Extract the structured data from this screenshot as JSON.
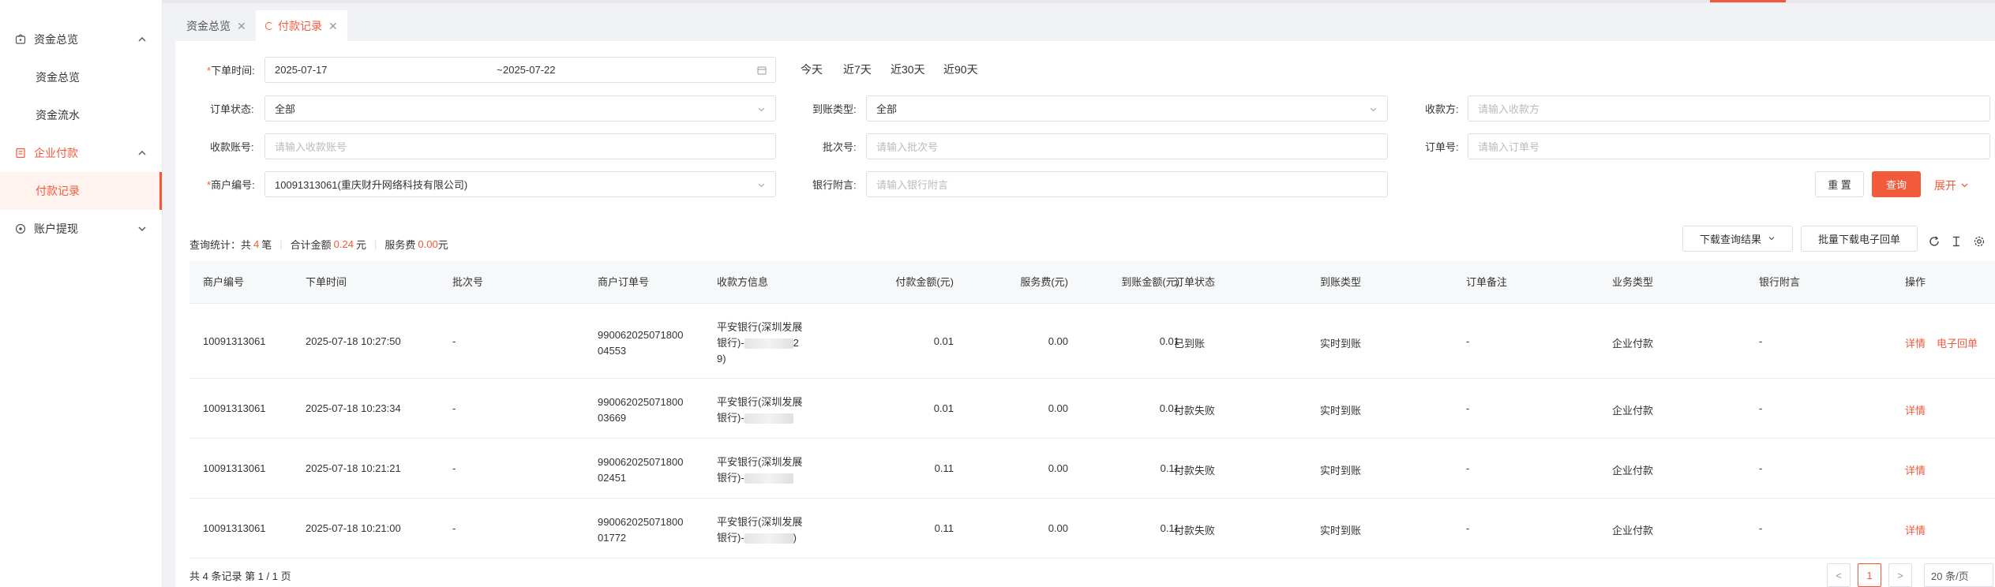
{
  "sidebar": {
    "groups": [
      {
        "label": "资金总览",
        "icon": "wallet-icon",
        "items": [
          "资金总览",
          "资金流水"
        ]
      },
      {
        "label": "企业付款",
        "icon": "document-icon",
        "items": [
          "付款记录"
        ]
      },
      {
        "label": "账户提现",
        "icon": "withdraw-icon",
        "items": []
      }
    ]
  },
  "tabs": [
    {
      "label": "资金总览"
    },
    {
      "label": "付款记录"
    }
  ],
  "filters": {
    "order_time_label": "下单时间:",
    "date_start": "2025-07-17",
    "date_sep": "~",
    "date_end": "2025-07-22",
    "quick": [
      "今天",
      "近7天",
      "近30天",
      "近90天"
    ],
    "order_status_label": "订单状态:",
    "order_status_value": "全部",
    "arrival_type_label": "到账类型:",
    "arrival_type_value": "全部",
    "payee_label": "收款方:",
    "payee_placeholder": "请输入收款方",
    "account_label": "收款账号:",
    "account_placeholder": "请输入收款账号",
    "batch_label": "批次号:",
    "batch_placeholder": "请输入批次号",
    "order_no_label": "订单号:",
    "order_no_placeholder": "请输入订单号",
    "merchant_label": "商户编号:",
    "merchant_value": "10091313061(重庆财升网络科技有限公司)",
    "bank_note_label": "银行附言:",
    "bank_note_placeholder": "请输入银行附言",
    "reset": "重 置",
    "search": "查询",
    "expand": "展开"
  },
  "stats": {
    "prefix": "查询统计：共",
    "count": "4",
    "count_unit": "笔",
    "amount_label": "合计金额",
    "amount": "0.24",
    "amount_unit": "元",
    "fee_label": "服务费",
    "fee": "0.00",
    "fee_unit": "元"
  },
  "toolbar": {
    "download": "下载查询结果",
    "batch_download": "批量下载电子回单"
  },
  "table": {
    "headers": [
      "商户编号",
      "下单时间",
      "批次号",
      "商户订单号",
      "收款方信息",
      "付款金额(元)",
      "服务费(元)",
      "到账金额(元)",
      "订单状态",
      "到账类型",
      "订单备注",
      "业务类型",
      "银行附言",
      "操作"
    ],
    "rows": [
      {
        "merchant": "10091313061",
        "time": "2025-07-18 10:27:50",
        "batch": "-",
        "order_l1": "990062025071800",
        "order_l2": "04553",
        "payee_l1": "平安银行(深圳发展",
        "payee_l2": "银行)-",
        "payee_tail2": "2",
        "payee_l3": "9)",
        "amount": "0.01",
        "fee": "0.00",
        "arrival": "0.01",
        "status": "已到账",
        "type": "实时到账",
        "remark": "-",
        "biz": "企业付款",
        "note": "-",
        "ops": [
          "详情",
          "电子回单"
        ]
      },
      {
        "merchant": "10091313061",
        "time": "2025-07-18 10:23:34",
        "batch": "-",
        "order_l1": "990062025071800",
        "order_l2": "03669",
        "payee_l1": "平安银行(深圳发展",
        "payee_l2": "银行)-",
        "payee_tail2": "",
        "payee_l3": "",
        "amount": "0.01",
        "fee": "0.00",
        "arrival": "0.01",
        "status": "付款失败",
        "type": "实时到账",
        "remark": "-",
        "biz": "企业付款",
        "note": "-",
        "ops": [
          "详情"
        ]
      },
      {
        "merchant": "10091313061",
        "time": "2025-07-18 10:21:21",
        "batch": "-",
        "order_l1": "990062025071800",
        "order_l2": "02451",
        "payee_l1": "平安银行(深圳发展",
        "payee_l2": "银行)-",
        "payee_tail2": "",
        "payee_l3": "",
        "amount": "0.11",
        "fee": "0.00",
        "arrival": "0.11",
        "status": "付款失败",
        "type": "实时到账",
        "remark": "-",
        "biz": "企业付款",
        "note": "-",
        "ops": [
          "详情"
        ]
      },
      {
        "merchant": "10091313061",
        "time": "2025-07-18 10:21:00",
        "batch": "-",
        "order_l1": "990062025071800",
        "order_l2": "01772",
        "payee_l1": "平安银行(深圳发展",
        "payee_l2": "银行)-",
        "payee_tail2": ")",
        "payee_l3": "",
        "amount": "0.11",
        "fee": "0.00",
        "arrival": "0.11",
        "status": "付款失败",
        "type": "实时到账",
        "remark": "-",
        "biz": "企业付款",
        "note": "-",
        "ops": [
          "详情"
        ]
      }
    ]
  },
  "pagination": {
    "summary": "共 4 条记录 第 1 / 1 页",
    "prev": "<",
    "current": "1",
    "next": ">",
    "page_size": "20 条/页"
  },
  "colors": {
    "accent": "#f25a3c"
  }
}
